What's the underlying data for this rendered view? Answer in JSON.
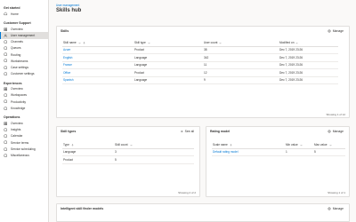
{
  "sidebar": {
    "groups": [
      {
        "title": "Get started",
        "items": [
          {
            "label": "Home",
            "icon": "home-icon"
          }
        ]
      },
      {
        "title": "Customer Support",
        "items": [
          {
            "label": "Overview",
            "icon": "overview-icon"
          },
          {
            "label": "User management",
            "icon": "users-icon"
          },
          {
            "label": "Channels",
            "icon": "channels-icon"
          },
          {
            "label": "Queues",
            "icon": "queues-icon"
          },
          {
            "label": "Routing",
            "icon": "routing-icon"
          },
          {
            "label": "Workstreams",
            "icon": "workstreams-icon"
          },
          {
            "label": "Case settings",
            "icon": "case-icon"
          },
          {
            "label": "Customer settings",
            "icon": "customer-icon"
          }
        ]
      },
      {
        "title": "Experiences",
        "items": [
          {
            "label": "Overview",
            "icon": "overview-icon"
          },
          {
            "label": "Workspaces",
            "icon": "workspaces-icon"
          },
          {
            "label": "Productivity",
            "icon": "productivity-icon"
          },
          {
            "label": "Knowledge",
            "icon": "knowledge-icon"
          }
        ]
      },
      {
        "title": "Operations",
        "items": [
          {
            "label": "Overview",
            "icon": "overview-icon"
          },
          {
            "label": "Insights",
            "icon": "insights-icon"
          },
          {
            "label": "Calendar",
            "icon": "calendar-icon"
          },
          {
            "label": "Service terms",
            "icon": "terms-icon"
          },
          {
            "label": "Service scheduling",
            "icon": "scheduling-icon"
          },
          {
            "label": "Miscellaneous",
            "icon": "misc-icon"
          }
        ]
      }
    ],
    "active": "User management"
  },
  "breadcrumb": "User management",
  "title": "Skills hub",
  "skills": {
    "title": "Skills",
    "action": "Manage",
    "columns": [
      "Skill name",
      "Skill type",
      "User count",
      "Modified on"
    ],
    "rows": [
      [
        "Azure",
        "Product",
        "38",
        "Dec 7, 2019 23:26"
      ],
      [
        "English",
        "Language",
        "342",
        "Dec 7, 2019 23:26"
      ],
      [
        "France",
        "Language",
        "11",
        "Dec 7, 2019 23:26"
      ],
      [
        "Office",
        "Product",
        "12",
        "Dec 7, 2019 23:26"
      ],
      [
        "Spanish",
        "Language",
        "9",
        "Dec 7, 2019 23:26"
      ]
    ],
    "showing": "Showing 1 of 12"
  },
  "skill_types": {
    "title": "Skill types",
    "action": "See all",
    "columns": [
      "Type",
      "Skill count"
    ],
    "rows": [
      [
        "Language",
        "3"
      ],
      [
        "Product",
        "5"
      ]
    ],
    "showing": "Showing 2 of 2"
  },
  "rating_model": {
    "title": "Rating model",
    "action": "Manage",
    "columns": [
      "Scale name",
      "Min value",
      "Max value"
    ],
    "rows": [
      [
        "Default rating model",
        "1",
        "5"
      ]
    ],
    "showing": "Showing 1 of 1"
  },
  "finder": {
    "title": "Intelligent skill finder models",
    "action": "Manage"
  }
}
